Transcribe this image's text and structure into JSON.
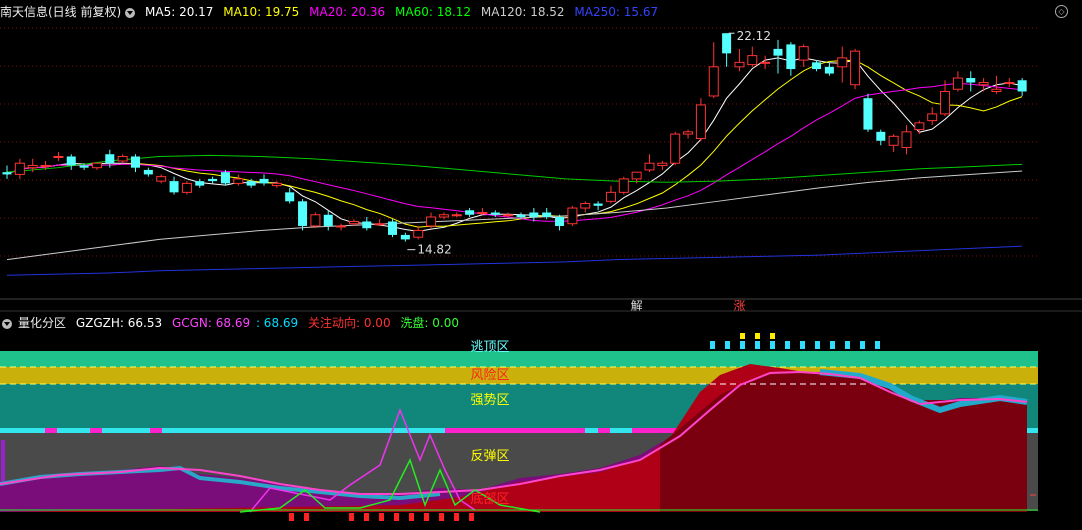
{
  "main": {
    "title": "南天信息(日线 前复权)",
    "ma": [
      {
        "label": "MA5: 20.17",
        "color": "#ffffff"
      },
      {
        "label": "MA10: 19.75",
        "color": "#ffff00"
      },
      {
        "label": "MA20: 20.36",
        "color": "#ff00ff"
      },
      {
        "label": "MA60: 18.12",
        "color": "#00ff00"
      },
      {
        "label": "MA120: 18.52",
        "color": "#cccccc"
      },
      {
        "label": "MA250: 15.67",
        "color": "#3344ff"
      }
    ],
    "high_label": "22.12",
    "low_label": "14.82",
    "marker_jie": "解",
    "marker_zhang": "涨",
    "candles": [
      [
        15.9,
        15.8,
        16.2,
        15.6
      ],
      [
        15.8,
        16.3,
        16.5,
        15.6
      ],
      [
        16.1,
        16.2,
        16.5,
        15.9
      ],
      [
        16.2,
        16.2,
        16.4,
        16.0
      ],
      [
        16.6,
        16.6,
        16.8,
        16.4
      ],
      [
        16.6,
        16.2,
        16.7,
        16.0
      ],
      [
        16.2,
        16.1,
        16.3,
        16.0
      ],
      [
        16.1,
        16.3,
        16.3,
        16.0
      ],
      [
        16.7,
        16.3,
        16.9,
        16.1
      ],
      [
        16.4,
        16.6,
        16.7,
        16.3
      ],
      [
        16.6,
        16.1,
        16.7,
        15.9
      ],
      [
        16.0,
        15.8,
        16.1,
        15.7
      ],
      [
        15.5,
        15.7,
        15.8,
        15.4
      ],
      [
        15.5,
        15.0,
        15.7,
        14.9
      ],
      [
        15.0,
        15.4,
        15.5,
        14.9
      ],
      [
        15.5,
        15.3,
        15.6,
        15.2
      ],
      [
        15.6,
        15.5,
        15.7,
        15.4
      ],
      [
        15.9,
        15.4,
        16.0,
        15.3
      ],
      [
        15.4,
        15.6,
        15.8,
        15.3
      ],
      [
        15.5,
        15.3,
        15.6,
        15.2
      ],
      [
        15.6,
        15.4,
        15.8,
        15.3
      ],
      [
        15.3,
        15.4,
        15.5,
        15.2
      ],
      [
        15.0,
        14.6,
        15.2,
        14.5
      ],
      [
        14.6,
        13.5,
        14.7,
        13.3
      ],
      [
        13.5,
        14.0,
        14.1,
        13.4
      ],
      [
        14.0,
        13.5,
        14.2,
        13.3
      ],
      [
        13.5,
        13.5,
        13.6,
        13.3
      ],
      [
        13.6,
        13.7,
        13.8,
        13.5
      ],
      [
        13.7,
        13.4,
        13.9,
        13.3
      ],
      [
        13.6,
        13.6,
        13.8,
        13.5
      ],
      [
        13.7,
        13.1,
        13.8,
        13.0
      ],
      [
        13.1,
        12.9,
        13.2,
        12.8
      ],
      [
        13.0,
        13.3,
        13.5,
        12.9
      ],
      [
        13.5,
        13.9,
        14.1,
        13.4
      ],
      [
        13.9,
        14.0,
        14.1,
        13.8
      ],
      [
        14.0,
        14.0,
        14.1,
        13.9
      ],
      [
        14.2,
        14.0,
        14.3,
        13.9
      ],
      [
        14.1,
        14.1,
        14.3,
        14.0
      ],
      [
        14.1,
        14.0,
        14.2,
        13.9
      ],
      [
        14.0,
        14.0,
        14.1,
        13.9
      ],
      [
        14.0,
        13.9,
        14.1,
        13.8
      ],
      [
        14.1,
        13.9,
        14.3,
        13.7
      ],
      [
        14.1,
        13.9,
        14.3,
        13.8
      ],
      [
        13.9,
        13.5,
        14.0,
        13.3
      ],
      [
        13.6,
        14.3,
        14.4,
        13.5
      ],
      [
        14.3,
        14.5,
        14.6,
        14.1
      ],
      [
        14.5,
        14.4,
        14.6,
        14.2
      ],
      [
        14.6,
        15.0,
        15.3,
        14.5
      ],
      [
        15.0,
        15.6,
        15.7,
        14.9
      ],
      [
        15.6,
        15.9,
        15.9,
        15.4
      ],
      [
        16.0,
        16.3,
        16.7,
        15.9
      ],
      [
        16.2,
        16.3,
        16.4,
        16.0
      ],
      [
        16.3,
        17.6,
        17.7,
        16.2
      ],
      [
        17.6,
        17.7,
        17.8,
        17.4
      ],
      [
        17.4,
        18.9,
        19.2,
        17.3
      ],
      [
        19.3,
        20.6,
        21.7,
        19.2
      ],
      [
        22.1,
        21.2,
        22.1,
        20.6
      ],
      [
        20.6,
        20.8,
        21.4,
        20.4
      ],
      [
        20.7,
        21.1,
        21.5,
        20.6
      ],
      [
        20.8,
        20.8,
        21.1,
        20.5
      ],
      [
        21.4,
        21.1,
        21.8,
        20.3
      ],
      [
        21.6,
        20.5,
        21.7,
        20.2
      ],
      [
        20.9,
        21.5,
        21.6,
        20.6
      ],
      [
        20.8,
        20.5,
        20.9,
        20.4
      ],
      [
        20.6,
        20.3,
        20.8,
        20.2
      ],
      [
        20.6,
        21.0,
        21.5,
        19.9
      ],
      [
        19.8,
        21.3,
        21.4,
        19.6
      ],
      [
        19.2,
        17.8,
        19.4,
        17.7
      ],
      [
        17.7,
        17.3,
        17.8,
        17.1
      ],
      [
        17.1,
        17.5,
        17.6,
        16.8
      ],
      [
        17.0,
        17.7,
        18.0,
        16.7
      ],
      [
        17.8,
        18.1,
        18.2,
        17.6
      ],
      [
        18.2,
        18.5,
        18.8,
        18.0
      ],
      [
        18.5,
        19.5,
        20.0,
        18.4
      ],
      [
        19.6,
        20.1,
        20.4,
        19.5
      ],
      [
        20.1,
        19.9,
        20.4,
        19.5
      ],
      [
        19.8,
        19.9,
        20.1,
        19.5
      ],
      [
        19.5,
        19.6,
        20.2,
        19.4
      ],
      [
        19.9,
        19.9,
        20.1,
        19.7
      ],
      [
        20.0,
        19.5,
        20.1,
        19.3
      ]
    ]
  },
  "indicator": {
    "title": "量化分区",
    "values": [
      {
        "label": "GZGZH: 66.53",
        "color": "#ffffff"
      },
      {
        "label": "GCGN: 68.69",
        "color": "#ff44ff"
      },
      {
        "label": ": 68.69",
        "color": "#00ddff"
      },
      {
        "label": "关注动向: 0.00",
        "color": "#ff3333"
      },
      {
        "label": "洗盘: 0.00",
        "color": "#33ff33"
      }
    ],
    "zones": [
      {
        "label": "逃顶区",
        "color": "#66ffff"
      },
      {
        "label": "风险区",
        "color": "#ff2222"
      },
      {
        "label": "强势区",
        "color": "#ffff00"
      },
      {
        "label": "反弹区",
        "color": "#ffff00"
      },
      {
        "label": "底部区",
        "color": "#ff2222"
      }
    ]
  }
}
